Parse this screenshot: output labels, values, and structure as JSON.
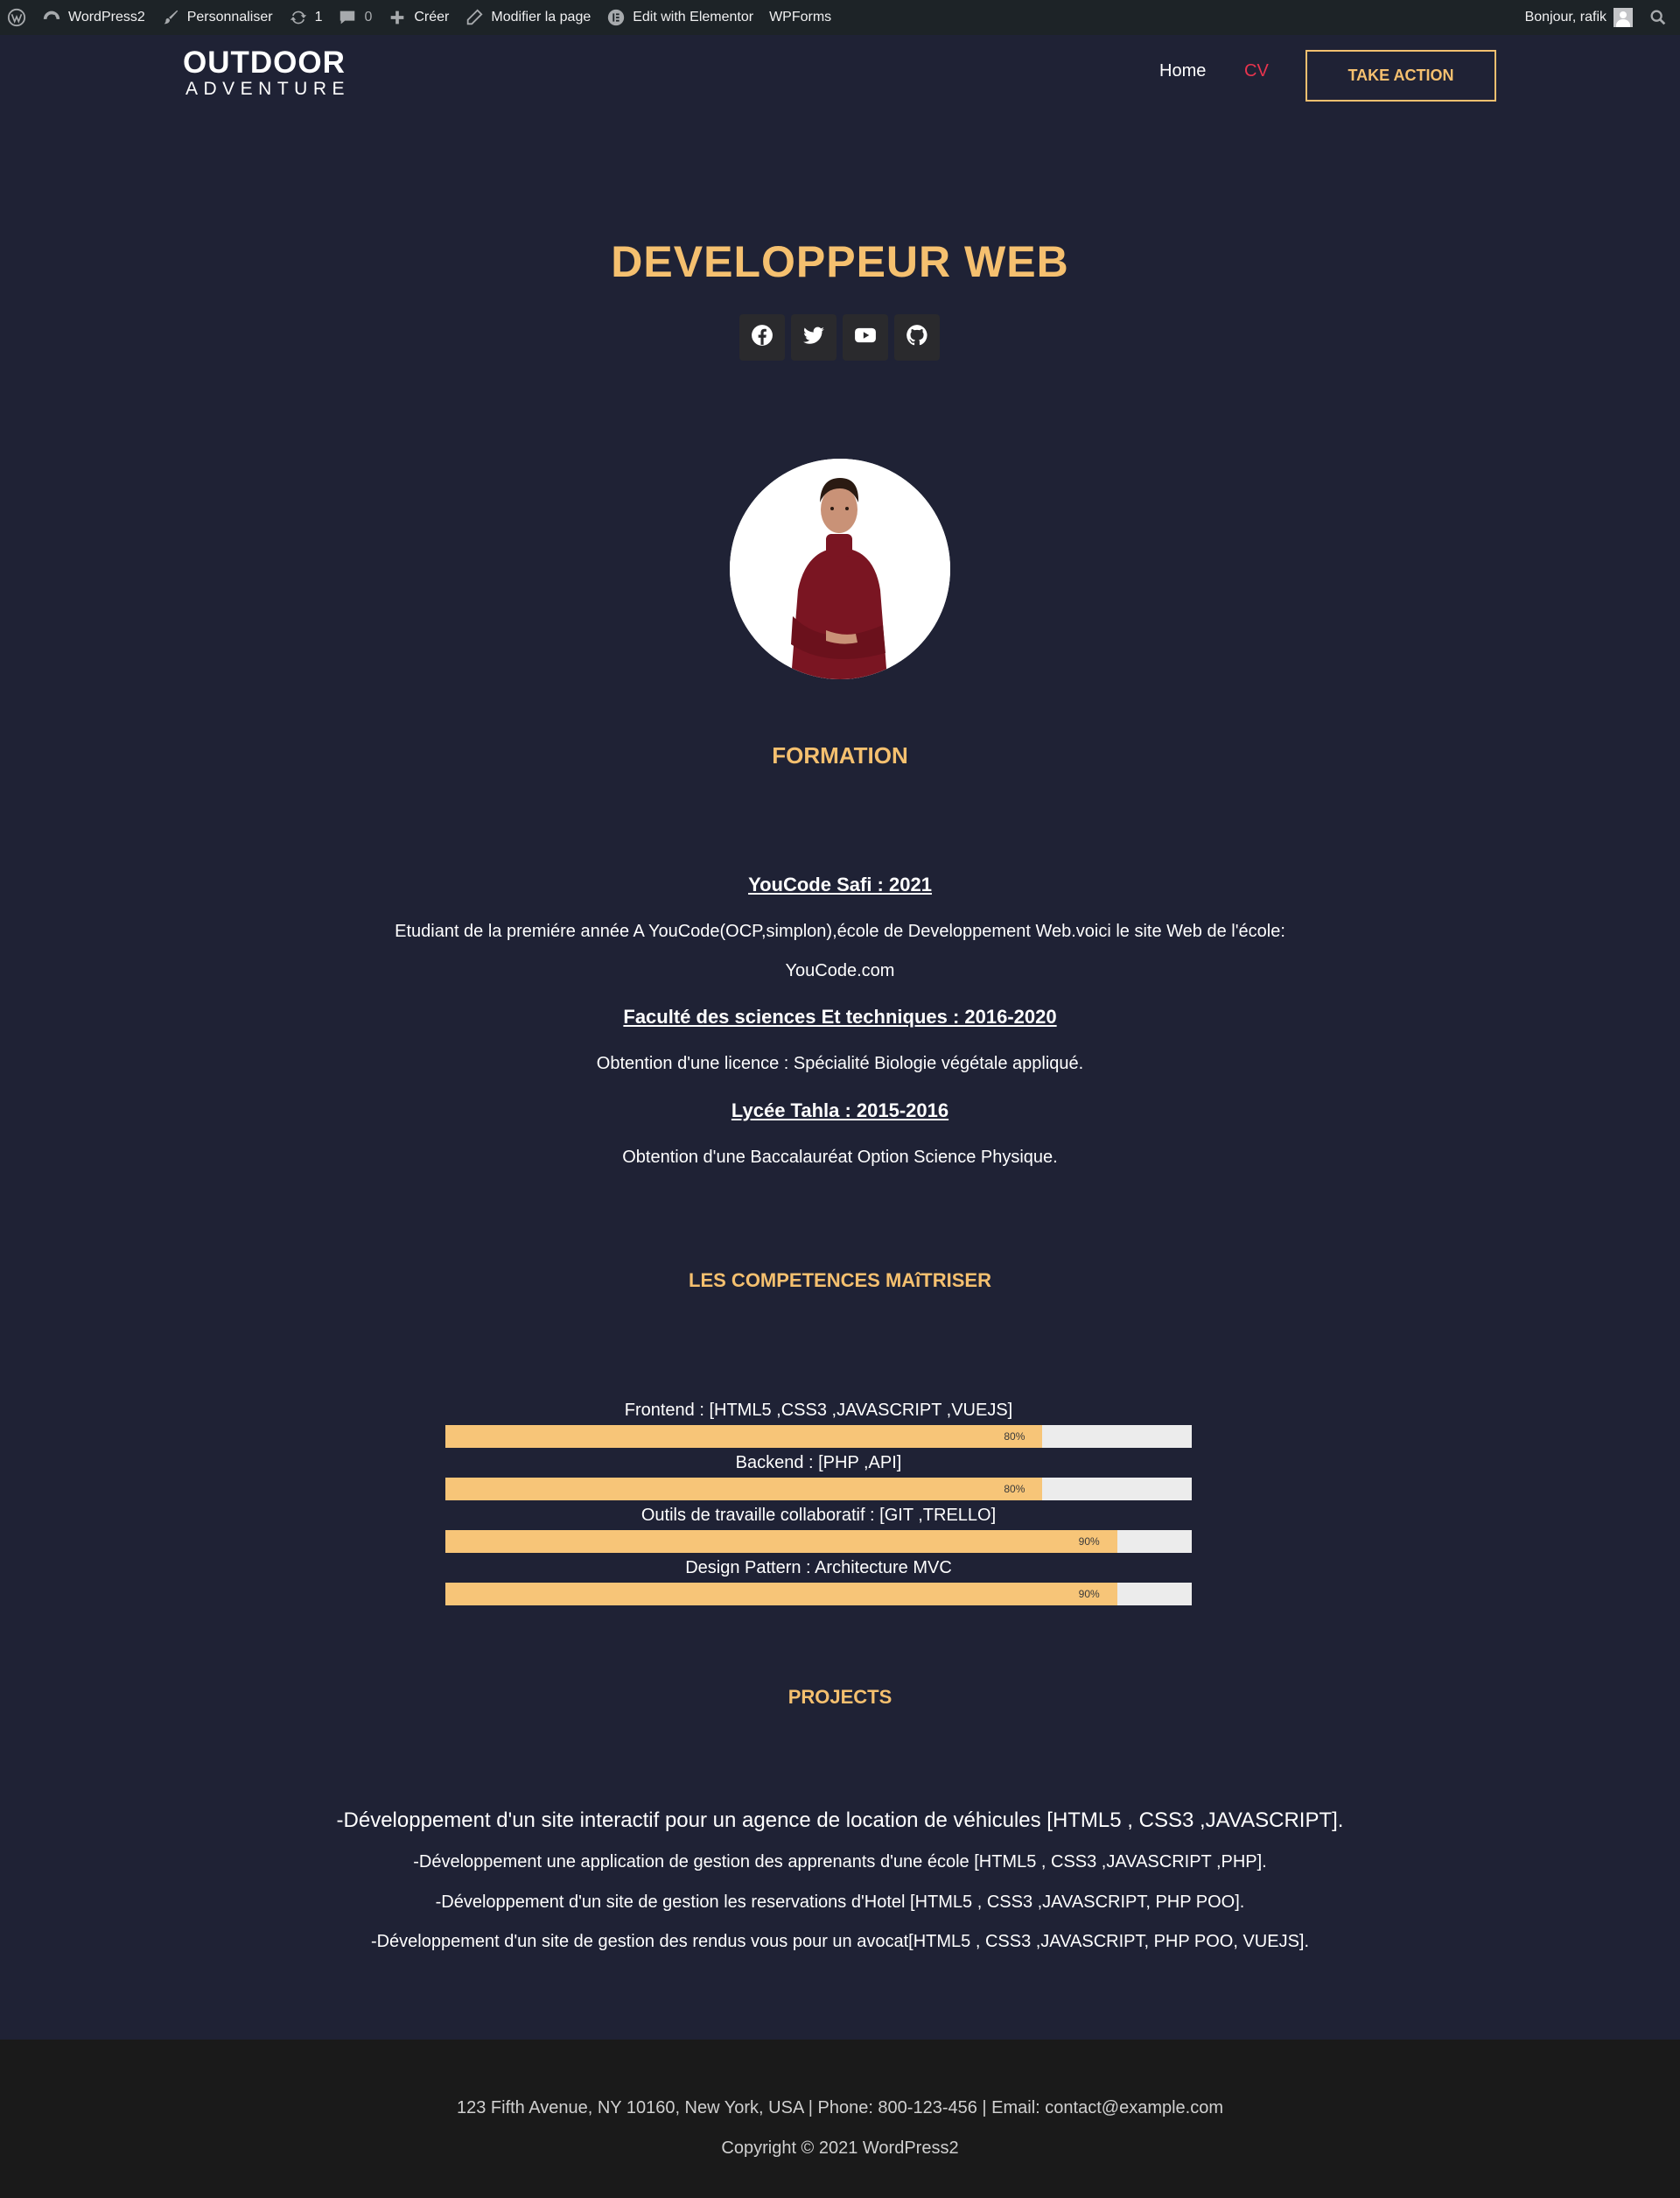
{
  "adminbar": {
    "site": "WordPress2",
    "customize": "Personnaliser",
    "updates": "1",
    "comments": "0",
    "new": "Créer",
    "edit": "Modifier la page",
    "elementor": "Edit with Elementor",
    "wpforms": "WPForms",
    "greeting": "Bonjour, rafik"
  },
  "header": {
    "logo_line1": "OUTDOOR",
    "logo_line2": "ADVENTURE",
    "nav": [
      "Home",
      "CV"
    ],
    "cta": "TAKE ACTION"
  },
  "hero": {
    "title": "DEVELOPPEUR WEB",
    "socials": [
      "facebook-icon",
      "twitter-icon",
      "youtube-icon",
      "github-icon"
    ]
  },
  "formation": {
    "title": "FORMATION",
    "items": [
      {
        "heading": "YouCode Safi : 2021",
        "text": "Etudiant de la premiére année A YouCode(OCP,simplon),école de Developpement Web.voici le site Web de l'école:",
        "text2": "YouCode.com"
      },
      {
        "heading": "Faculté des sciences Et techniques : 2016-2020",
        "text": "Obtention d'une licence : Spécialité Biologie végétale appliqué."
      },
      {
        "heading": "Lycée Tahla : 2015-2016",
        "text": "Obtention d'une Baccalauréat Option Science Physique."
      }
    ]
  },
  "skills": {
    "title": "LES COMPETENCES MAîTRISER",
    "items": [
      {
        "label": "Frontend : [HTML5 ,CSS3 ,JAVASCRIPT ,VUEJS]",
        "percent": 80,
        "percent_label": "80%"
      },
      {
        "label": "Backend : [PHP ,API]",
        "percent": 80,
        "percent_label": "80%"
      },
      {
        "label": "Outils de travaille collaboratif : [GIT ,TRELLO]",
        "percent": 90,
        "percent_label": "90%"
      },
      {
        "label": "Design Pattern : Architecture MVC",
        "percent": 90,
        "percent_label": "90%"
      }
    ]
  },
  "projects": {
    "title": "PROJECTS",
    "items": [
      "-Développement d'un site interactif pour un agence de location de véhicules [HTML5 , CSS3 ,JAVASCRIPT].",
      "-Développement une application de gestion des apprenants d'une école [HTML5 , CSS3 ,JAVASCRIPT ,PHP].",
      "-Développement d'un site de gestion les reservations d'Hotel [HTML5 , CSS3 ,JAVASCRIPT, PHP POO].",
      "-Développement d'un site de gestion des rendus vous pour un avocat[HTML5 , CSS3 ,JAVASCRIPT, PHP POO, VUEJS]."
    ]
  },
  "footer": {
    "contact": "123 Fifth Avenue, NY 10160, New York, USA | Phone: 800-123-456 | Email: contact@example.com",
    "copyright": "Copyright © 2021 WordPress2"
  },
  "colors": {
    "background": "#1f2235",
    "accent": "#f5c06f",
    "active_nav": "#e8344e",
    "footer": "#1a1a1a"
  }
}
